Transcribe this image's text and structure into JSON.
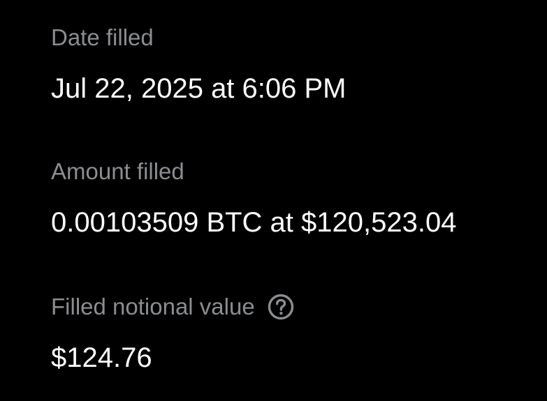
{
  "order_details": {
    "date_filled": {
      "label": "Date filled",
      "value": "Jul 22, 2025 at 6:06 PM"
    },
    "amount_filled": {
      "label": "Amount filled",
      "value": "0.00103509 BTC at $120,523.04"
    },
    "filled_notional_value": {
      "label": "Filled notional value",
      "value": "$124.76",
      "help_icon": "question-circle-icon"
    }
  },
  "colors": {
    "background": "#000000",
    "label": "#8b8d91",
    "value": "#ffffff"
  }
}
